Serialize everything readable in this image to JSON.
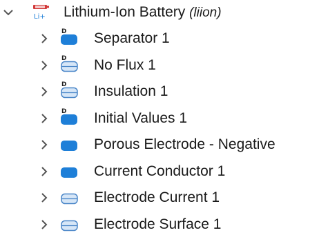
{
  "tree": {
    "root": {
      "label": "Lithium-Ion Battery",
      "tag": "(liion)",
      "icon": "lithium-ion-battery-icon",
      "icon_text": "Li+",
      "expanded": true
    },
    "children": [
      {
        "label": "Separator 1",
        "icon": "domain-solid-icon",
        "badge": "D"
      },
      {
        "label": "No Flux 1",
        "icon": "boundary-outline-icon",
        "badge": "D"
      },
      {
        "label": "Insulation 1",
        "icon": "boundary-outline-icon",
        "badge": "D"
      },
      {
        "label": "Initial Values 1",
        "icon": "domain-solid-icon",
        "badge": "D"
      },
      {
        "label": "Porous Electrode - Negative",
        "icon": "domain-solid-icon"
      },
      {
        "label": "Current Conductor 1",
        "icon": "domain-solid-icon"
      },
      {
        "label": "Electrode Current 1",
        "icon": "boundary-outline-icon"
      },
      {
        "label": "Electrode Surface 1",
        "icon": "boundary-outline-icon"
      }
    ]
  },
  "colors": {
    "solid_fill": "#1e7fd8",
    "outline_fill": "#d6e6f7",
    "outline_stroke": "#4a86c8",
    "chevron": "#555555",
    "battery_red": "#d23a3a"
  }
}
